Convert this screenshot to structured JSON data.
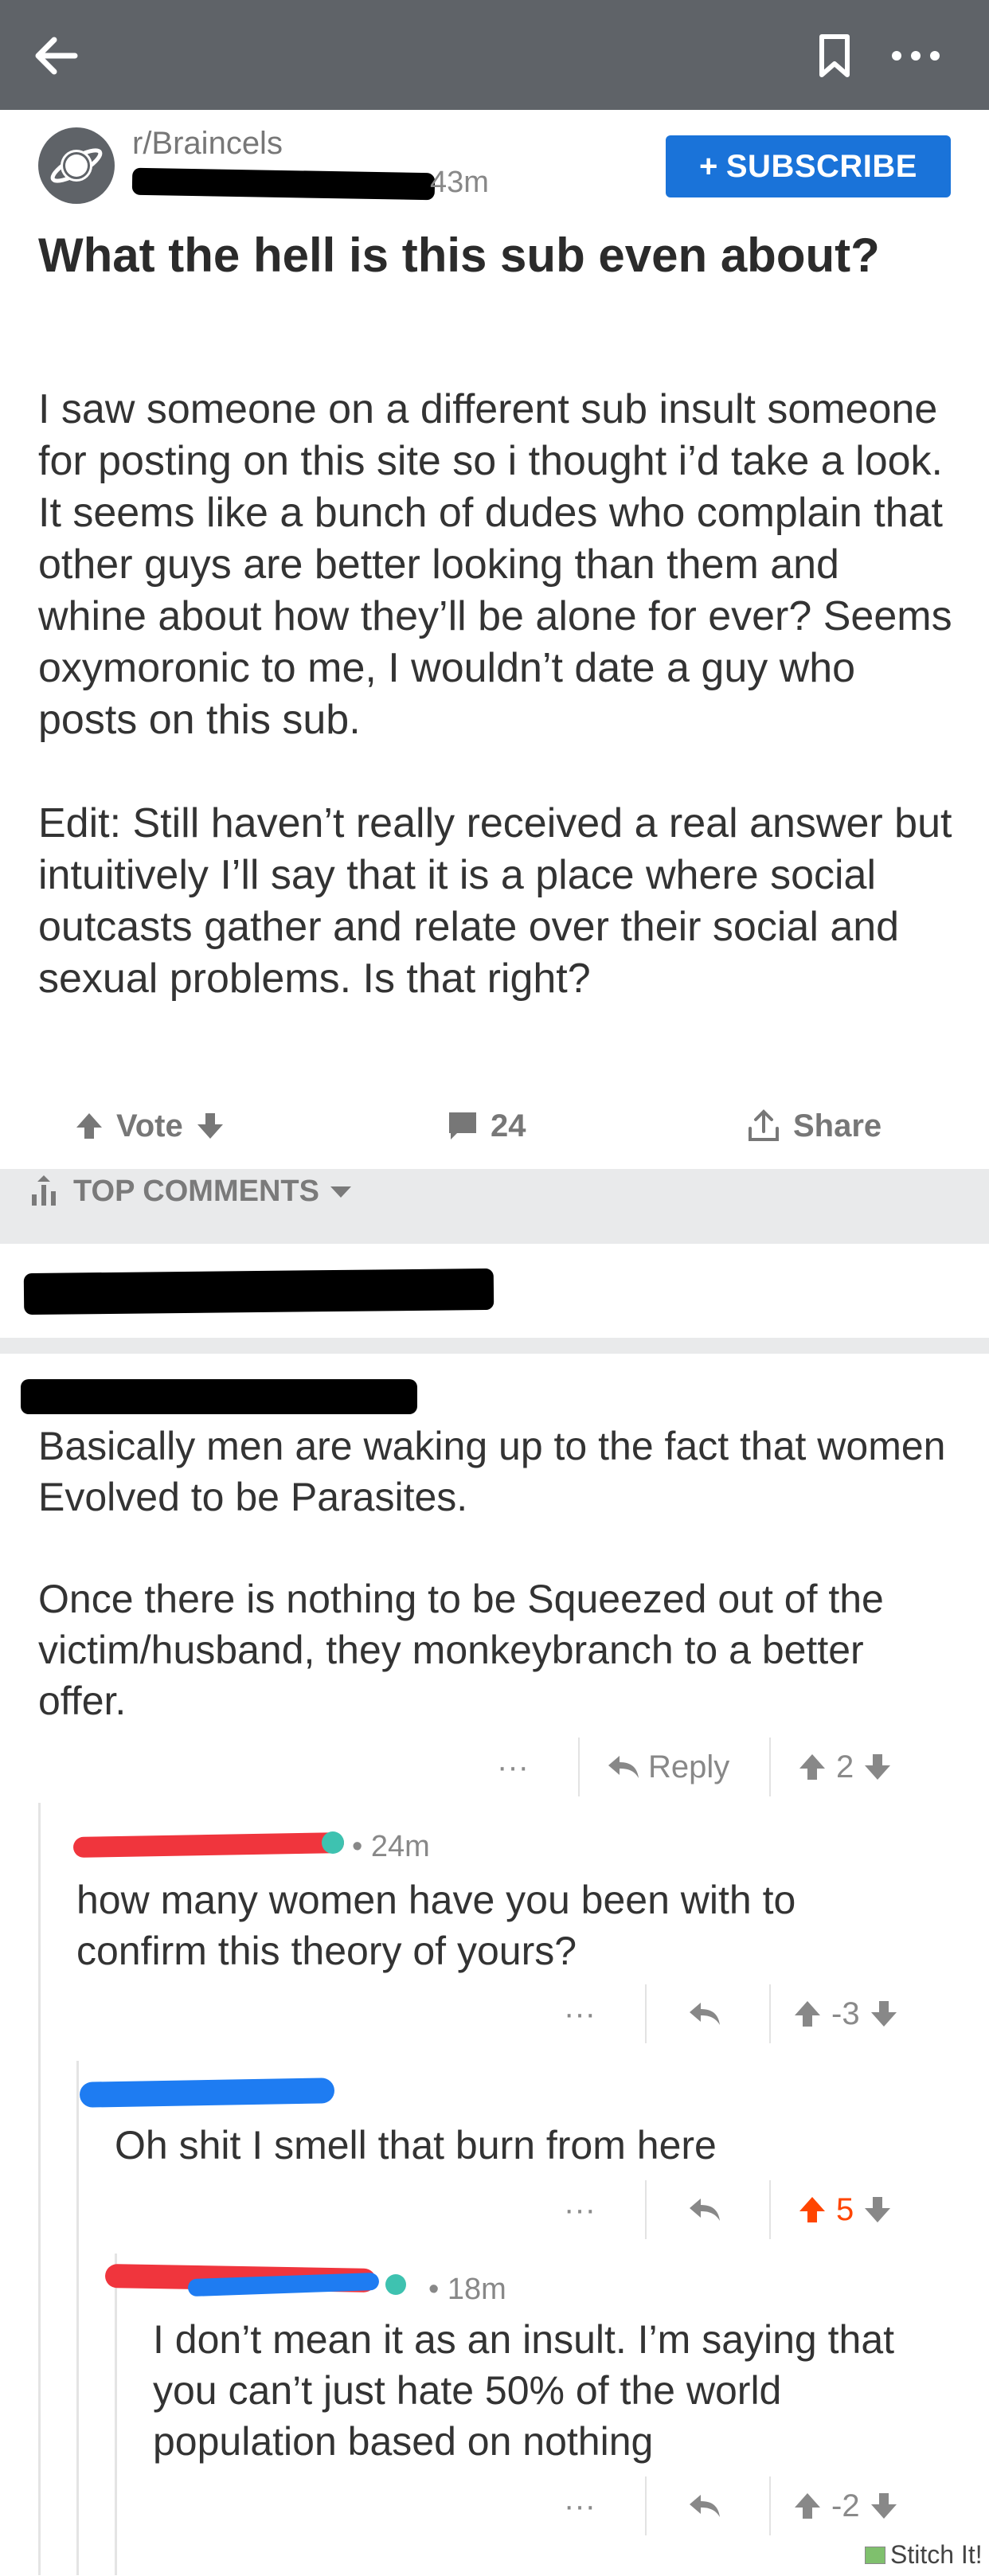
{
  "header": {
    "back_icon": "back-arrow-icon",
    "bookmark_icon": "bookmark-icon",
    "more_icon": "more-dots-icon"
  },
  "post": {
    "subreddit": "r/Braincels",
    "age": "43m",
    "subscribe_label": "SUBSCRIBE",
    "title": "What the hell is this sub even about?",
    "body": [
      "I saw someone on a different sub insult someone for posting on this site so i thought i’d take a look. It seems like a bunch of dudes who complain that other guys are better looking than them and whine about how they’ll be alone for ever? Seems oxymoronic to me, I wouldn’t date a guy who posts on this sub.",
      "Edit: Still haven’t really received a real answer but intuitively I’ll say that it is a place where social outcasts gather and relate over their social and sexual problems. Is that right?"
    ],
    "vote_label": "Vote",
    "comment_count": "24",
    "share_label": "Share"
  },
  "sort": {
    "label": "TOP COMMENTS"
  },
  "comments": [
    {
      "text": [
        "Basically men are waking up to the fact that women Evolved to be Parasites.",
        "Once there is nothing to be Squeezed out of the victim/husband, they monkeybranch to a better offer."
      ],
      "more": "···",
      "reply_label": "Reply",
      "score": "2"
    },
    {
      "time": "• 24m",
      "text": "how many women have you been with to confirm this theory of yours?",
      "more": "···",
      "score": "-3"
    },
    {
      "text": "Oh shit I smell that burn from here",
      "more": "···",
      "score": "5"
    },
    {
      "time": "• 18m",
      "text": "I don’t mean it as an insult. I’m saying that you can’t just hate 50% of the world population based on nothing",
      "more": "···",
      "score": "-2"
    }
  ],
  "watermark": "Stitch It!",
  "colors": {
    "topbar": "#5f6368",
    "accent": "#1a73d9",
    "upvoted": "#ff4500",
    "redact_red": "#f0353d",
    "redact_blue": "#1e7cf2"
  }
}
